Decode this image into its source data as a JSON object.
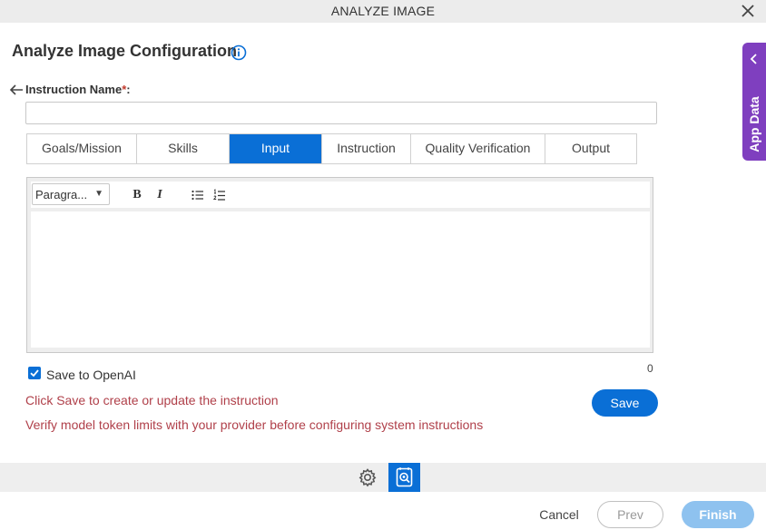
{
  "window": {
    "title": "ANALYZE IMAGE"
  },
  "page": {
    "title": "Analyze Image Configuration"
  },
  "side_panel": {
    "label": "App Data"
  },
  "instruction": {
    "label": "Instruction Name",
    "required_marker": "*",
    "colon": ":",
    "value": "",
    "placeholder": ""
  },
  "tabs": [
    {
      "label": "Goals/Mission",
      "active": false
    },
    {
      "label": "Skills",
      "active": false
    },
    {
      "label": "Input",
      "active": true
    },
    {
      "label": "Instruction",
      "active": false
    },
    {
      "label": "Quality Verification",
      "active": false
    },
    {
      "label": "Output",
      "active": false
    }
  ],
  "editor": {
    "format_select": "Paragra...",
    "bold_label": "B",
    "italic_label": "I",
    "content": "",
    "char_count": "0"
  },
  "save_to_openai": {
    "label": "Save to OpenAI",
    "checked": true
  },
  "messages": {
    "save_hint": "Click Save to create or update the instruction",
    "token_warning": "Verify model token limits with your provider before configuring system instructions"
  },
  "buttons": {
    "save": "Save",
    "cancel": "Cancel",
    "prev": "Prev",
    "finish": "Finish"
  },
  "colors": {
    "accent": "#0a6fd6",
    "side_panel": "#7f3fbf",
    "warning_text": "#b0404a",
    "finish_disabled": "#8ec2ef"
  }
}
